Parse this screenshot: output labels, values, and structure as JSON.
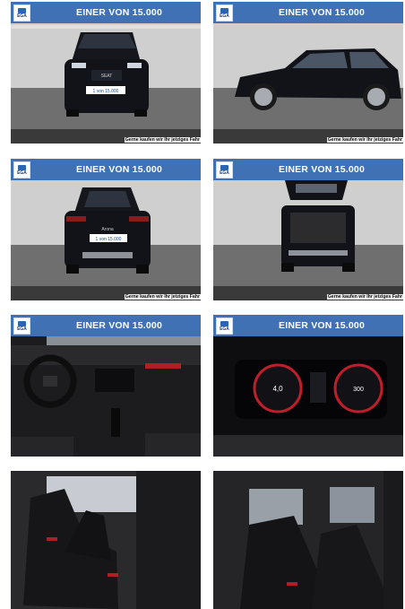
{
  "gallery": {
    "tiles": [
      {
        "banner": "EINER VON 15.000",
        "logo": "EGA",
        "caption": "Gerne kaufen wir Ihr jetziges Fahr",
        "plate": "1 von 15.000",
        "badge": "SEAT"
      },
      {
        "banner": "EINER VON 15.000",
        "logo": "EGA",
        "caption": "Gerne kaufen wir Ihr jetziges Fahr"
      },
      {
        "banner": "EINER VON 15.000",
        "logo": "EGA",
        "caption": "Gerne kaufen wir Ihr jetziges Fahr",
        "plate": "1 von 15.000",
        "badge": "Arona"
      },
      {
        "banner": "EINER VON 15.000",
        "logo": "EGA",
        "caption": "Gerne kaufen wir Ihr jetziges Fahr"
      },
      {
        "banner": "EINER VON 15.000",
        "logo": "EGA"
      },
      {
        "banner": "EINER VON 15.000",
        "logo": "EGA",
        "speed": "4,0",
        "range": "300"
      },
      {},
      {}
    ]
  },
  "colors": {
    "banner": "#4071b4",
    "car": "#111318",
    "wall": "#cfcfcf"
  },
  "icons": [
    "ega-logo-icon"
  ]
}
